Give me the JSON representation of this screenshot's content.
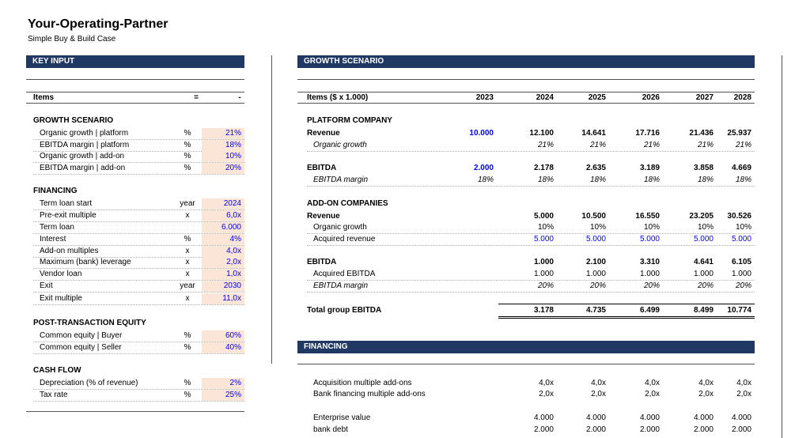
{
  "title": "Your-Operating-Partner",
  "subtitle": "Simple Buy & Build Case",
  "left": {
    "bar": "KEY INPUT",
    "header": {
      "items": "Items",
      "unit": "=",
      "value": "-"
    },
    "sections": [
      {
        "title": "GROWTH SCENARIO",
        "rows": [
          {
            "label": "Organic growth | platform",
            "unit": "%",
            "value": "21%"
          },
          {
            "label": "EBITDA margin | platform",
            "unit": "%",
            "value": "18%"
          },
          {
            "label": "Organic growth | add-on",
            "unit": "%",
            "value": "10%"
          },
          {
            "label": "EBITDA margin | add-on",
            "unit": "%",
            "value": "20%"
          }
        ]
      },
      {
        "title": "FINANCING",
        "rows": [
          {
            "label": "Term loan start",
            "unit": "year",
            "value": "2024"
          },
          {
            "label": "Pre-exit multiple",
            "unit": "x",
            "value": "6,0x"
          },
          {
            "label": "Term loan",
            "unit": "",
            "value": "6.000"
          },
          {
            "label": "Interest",
            "unit": "%",
            "value": "4%"
          },
          {
            "label": "Add-on multiples",
            "unit": "x",
            "value": "4,0x"
          },
          {
            "label": "Maximum (bank) leverage",
            "unit": "x",
            "value": "2,0x"
          },
          {
            "label": "Vendor loan",
            "unit": "x",
            "value": "1,0x"
          },
          {
            "label": "Exit",
            "unit": "year",
            "value": "2030"
          },
          {
            "label": "Exit multiple",
            "unit": "x",
            "value": "11,0x"
          }
        ]
      },
      {
        "title": "POST-TRANSACTION EQUITY",
        "rows": [
          {
            "label": "Common equity | Buyer",
            "unit": "%",
            "value": "60%"
          },
          {
            "label": "Common equity | Seller",
            "unit": "%",
            "value": "40%"
          }
        ]
      },
      {
        "title": "CASH FLOW",
        "rows": [
          {
            "label": "Depreciation (% of revenue)",
            "unit": "%",
            "value": "2%"
          },
          {
            "label": "Tax rate",
            "unit": "%",
            "value": "25%"
          }
        ]
      }
    ]
  },
  "growth": {
    "bar": "GROWTH SCENARIO",
    "header": {
      "items": "Items ($ x 1.000)",
      "years": [
        "2023",
        "2024",
        "2025",
        "2026",
        "2027",
        "2028"
      ]
    },
    "platform_title": "PLATFORM COMPANY",
    "platform_rows": [
      {
        "label": "Revenue",
        "style": "bold",
        "values": [
          "10.000",
          "12.100",
          "14.641",
          "17.716",
          "21.436",
          "25.937"
        ]
      },
      {
        "label": "Organic growth",
        "style": "ital",
        "values": [
          "",
          "21%",
          "21%",
          "21%",
          "21%",
          "21%"
        ]
      },
      {
        "label": "EBITDA",
        "style": "bold",
        "values": [
          "2.000",
          "2.178",
          "2.635",
          "3.189",
          "3.858",
          "4.669"
        ]
      },
      {
        "label": "EBITDA margin",
        "style": "ital",
        "values": [
          "18%",
          "18%",
          "18%",
          "18%",
          "18%",
          "18%"
        ]
      }
    ],
    "addon_title": "ADD-ON COMPANIES",
    "addon_rows": [
      {
        "label": "Revenue",
        "style": "bold",
        "values": [
          "",
          "5.000",
          "10.500",
          "16.550",
          "23.205",
          "30.526"
        ]
      },
      {
        "label": "Organic growth",
        "style": "",
        "values": [
          "",
          "10%",
          "10%",
          "10%",
          "10%",
          "10%"
        ]
      },
      {
        "label": "Acquired revenue",
        "style": "",
        "values": [
          "",
          "5.000",
          "5.000",
          "5.000",
          "5.000",
          "5.000"
        ]
      },
      {
        "label": "EBITDA",
        "style": "bold",
        "values": [
          "",
          "1.000",
          "2.100",
          "3.310",
          "4.641",
          "6.105"
        ]
      },
      {
        "label": "Acquired EBITDA",
        "style": "",
        "values": [
          "",
          "1.000",
          "1.000",
          "1.000",
          "1.000",
          "1.000"
        ]
      },
      {
        "label": "EBITDA margin",
        "style": "ital",
        "values": [
          "",
          "20%",
          "20%",
          "20%",
          "20%",
          "20%"
        ]
      }
    ],
    "total": {
      "label": "Total group EBITDA",
      "values": [
        "",
        "3.178",
        "4.735",
        "6.499",
        "8.499",
        "10.774"
      ]
    }
  },
  "financing": {
    "bar": "FINANCING",
    "rows": [
      {
        "label": "Acquisition multiple add-ons",
        "values": [
          "",
          "4,0x",
          "4,0x",
          "4,0x",
          "4,0x",
          "4,0x"
        ]
      },
      {
        "label": "Bank financing multiple add-ons",
        "values": [
          "",
          "2,0x",
          "2,0x",
          "2,0x",
          "2,0x",
          "2,0x"
        ]
      },
      {
        "label": "Enterprise value",
        "values": [
          "",
          "4.000",
          "4.000",
          "4.000",
          "4.000",
          "4.000"
        ]
      },
      {
        "label": "bank debt",
        "values": [
          "",
          "2.000",
          "2.000",
          "2.000",
          "2.000",
          "2.000"
        ]
      }
    ]
  },
  "colors": {
    "header_bar": "#1f3864",
    "input_fill": "#fbe5d6",
    "input_text": "#0000ff"
  }
}
